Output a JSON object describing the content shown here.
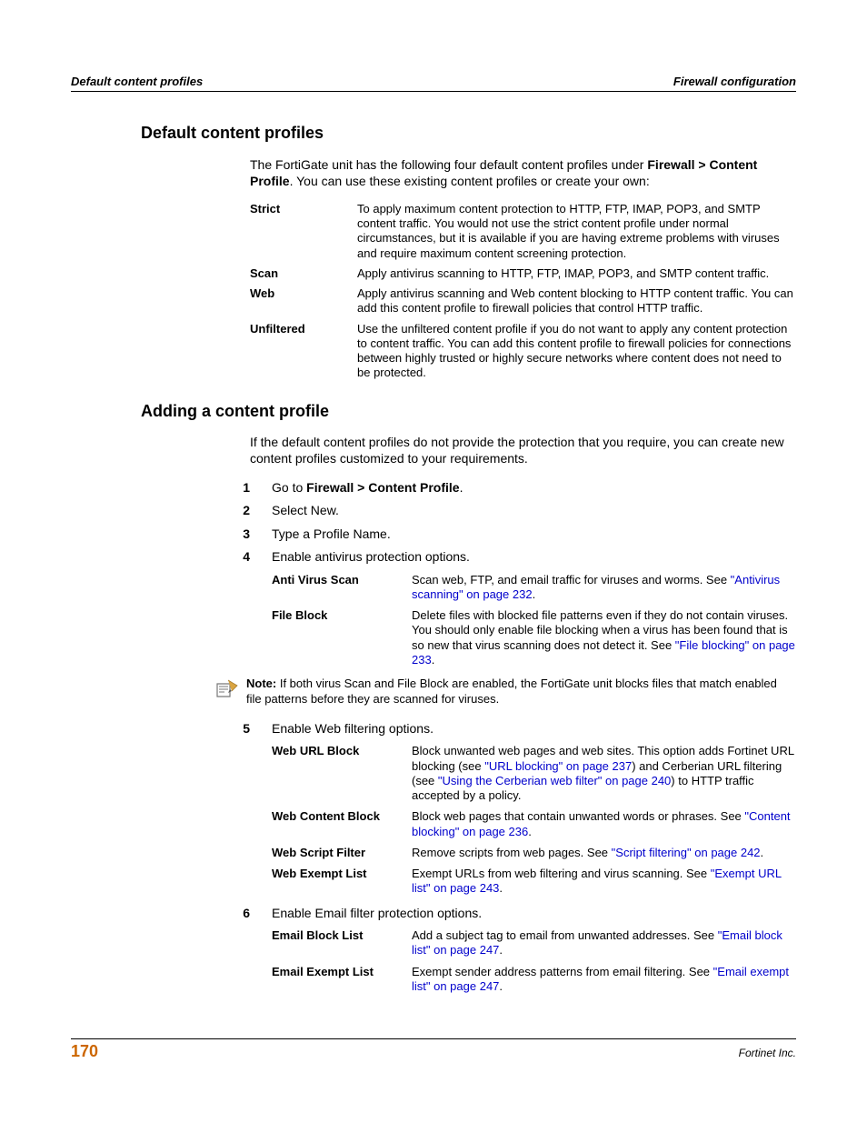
{
  "header": {
    "left": "Default content profiles",
    "right": "Firewall configuration"
  },
  "sec1": {
    "title": "Default content profiles",
    "intro_before": "The FortiGate unit has the following four default content profiles under ",
    "intro_bold1": "Firewall > Content Profile",
    "intro_after": ". You can use these existing content profiles or create your own:",
    "rows": [
      {
        "term": "Strict",
        "desc": "To apply maximum content protection to HTTP, FTP, IMAP, POP3, and SMTP content traffic. You would not use the strict content profile under normal circumstances, but it is available if you are having extreme problems with viruses and require maximum content screening protection."
      },
      {
        "term": "Scan",
        "desc": "Apply antivirus scanning to HTTP, FTP, IMAP, POP3, and SMTP content traffic."
      },
      {
        "term": "Web",
        "desc": "Apply antivirus scanning and Web content blocking to HTTP content traffic. You can add this content profile to firewall policies that control HTTP traffic."
      },
      {
        "term": "Unfiltered",
        "desc": "Use the unfiltered content profile if you do not want to apply any content protection to content traffic. You can add this content profile to firewall policies for connections between highly trusted or highly secure networks where content does not need to be protected."
      }
    ]
  },
  "sec2": {
    "title": "Adding a content profile",
    "intro": "If the default content profiles do not provide the protection that you require, you can create new content profiles customized to your requirements.",
    "steps": {
      "s1_num": "1",
      "s1_a": "Go to ",
      "s1_bold": "Firewall > Content Profile",
      "s1_b": ".",
      "s2_num": "2",
      "s2_text": "Select New.",
      "s3_num": "3",
      "s3_text": "Type a Profile Name.",
      "s4_num": "4",
      "s4_text": "Enable antivirus protection options.",
      "s5_num": "5",
      "s5_text": "Enable Web filtering options.",
      "s6_num": "6",
      "s6_text": "Enable Email filter protection options."
    },
    "av": {
      "r1_term": "Anti Virus Scan",
      "r1_a": "Scan web, FTP, and email traffic for viruses and worms. See ",
      "r1_link": "\"Antivirus scanning\" on page 232",
      "r1_b": ".",
      "r2_term": "File Block",
      "r2_a": "Delete files with blocked file patterns even if they do not contain viruses. You should only enable file blocking when a virus has been found that is so new that virus scanning does not detect it. See ",
      "r2_link": "\"File blocking\" on page 233",
      "r2_b": "."
    },
    "note": {
      "label": "Note:",
      "text": " If both virus Scan and File Block are enabled, the FortiGate unit blocks files that match enabled file patterns before they are scanned for viruses."
    },
    "web": {
      "r1_term": "Web URL Block",
      "r1_a": "Block unwanted web pages and web sites. This option adds Fortinet URL blocking (see ",
      "r1_link1": "\"URL blocking\" on page 237",
      "r1_b": ") and Cerberian URL filtering (see ",
      "r1_link2": "\"Using the Cerberian web filter\" on page 240",
      "r1_c": ") to HTTP traffic accepted by a policy.",
      "r2_term": "Web Content Block",
      "r2_a": "Block web pages that contain unwanted words or phrases. See ",
      "r2_link": "\"Content blocking\" on page 236",
      "r2_b": ".",
      "r3_term": "Web Script Filter",
      "r3_a": "Remove scripts from web pages. See ",
      "r3_link": "\"Script filtering\" on page 242",
      "r3_b": ".",
      "r4_term": "Web Exempt List",
      "r4_a": "Exempt URLs from web filtering and virus scanning. See ",
      "r4_link": "\"Exempt URL list\" on page 243",
      "r4_b": "."
    },
    "email": {
      "r1_term": "Email Block List",
      "r1_a": "Add a subject tag to email from unwanted addresses. See ",
      "r1_link": "\"Email block list\" on page 247",
      "r1_b": ".",
      "r2_term": "Email Exempt List",
      "r2_a": "Exempt sender address patterns from email filtering. See ",
      "r2_link": "\"Email exempt list\" on page 247",
      "r2_b": "."
    }
  },
  "footer": {
    "page": "170",
    "company": "Fortinet Inc."
  }
}
